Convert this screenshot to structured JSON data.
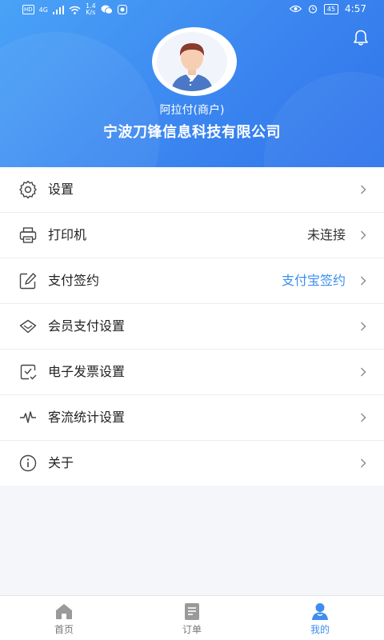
{
  "status_bar": {
    "hd": "HD",
    "network": "4G",
    "speed_value": "1.4",
    "speed_unit": "K/s",
    "battery": "45",
    "time": "4:57"
  },
  "profile": {
    "role": "阿拉付(商户)",
    "company": "宁波刀锋信息科技有限公司"
  },
  "menu": [
    {
      "label": "设置",
      "value": "",
      "icon": "gear-icon"
    },
    {
      "label": "打印机",
      "value": "未连接",
      "icon": "printer-icon"
    },
    {
      "label": "支付签约",
      "value": "支付宝签约",
      "icon": "edit-icon"
    },
    {
      "label": "会员支付设置",
      "value": "",
      "icon": "diamond-icon"
    },
    {
      "label": "电子发票设置",
      "value": "",
      "icon": "invoice-icon"
    },
    {
      "label": "客流统计设置",
      "value": "",
      "icon": "pulse-icon"
    },
    {
      "label": "关于",
      "value": "",
      "icon": "info-icon"
    }
  ],
  "tabs": [
    {
      "label": "首页",
      "icon": "home-icon"
    },
    {
      "label": "订单",
      "icon": "order-icon"
    },
    {
      "label": "我的",
      "icon": "user-icon"
    }
  ],
  "colors": {
    "header_start": "#4aa3f7",
    "header_end": "#2f74ea",
    "accent": "#3d8ef0"
  }
}
